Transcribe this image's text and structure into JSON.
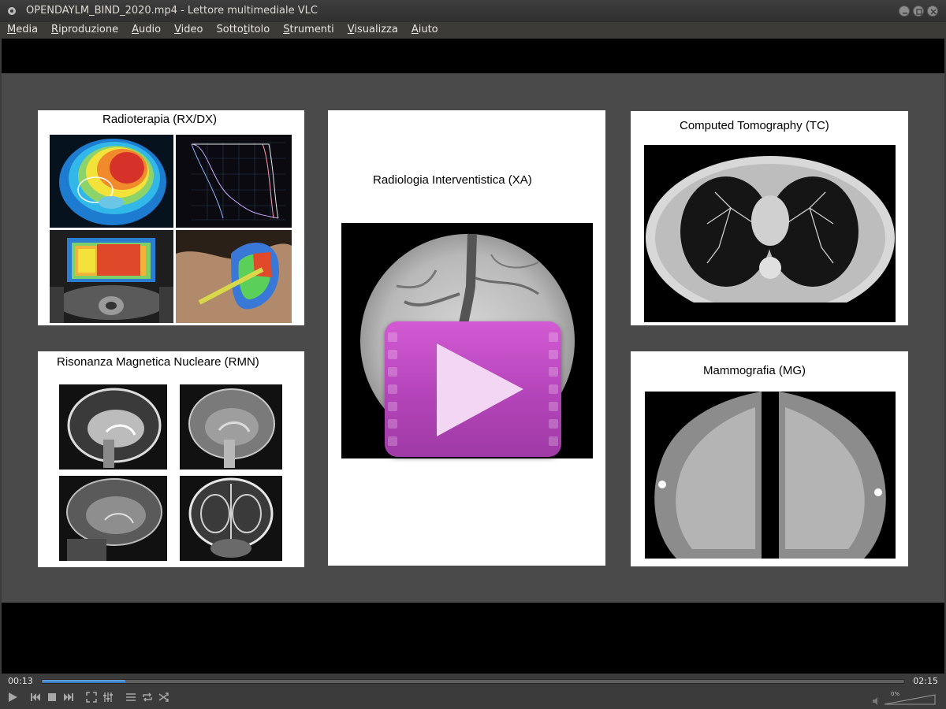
{
  "window": {
    "title": "OPENDAYLM_BIND_2020.mp4 - Lettore multimediale VLC"
  },
  "menu": [
    {
      "pre": "",
      "key": "M",
      "post": "edia"
    },
    {
      "pre": "",
      "key": "R",
      "post": "iproduzione"
    },
    {
      "pre": "",
      "key": "A",
      "post": "udio"
    },
    {
      "pre": "",
      "key": "V",
      "post": "ideo"
    },
    {
      "pre": "Sotto",
      "key": "t",
      "post": "itolo"
    },
    {
      "pre": "",
      "key": "S",
      "post": "trumenti"
    },
    {
      "pre": "",
      "key": "V",
      "post": "isualizza"
    },
    {
      "pre": "",
      "key": "A",
      "post": "iuto"
    }
  ],
  "slide": {
    "radioterapia": "Radioterapia (RX/DX)",
    "radiologia": "Radiologia Interventistica (XA)",
    "tc": "Computed Tomography (TC)",
    "rmn": "Risonanza Magnetica Nucleare (RMN)",
    "mammografia": "Mammografia (MG)"
  },
  "player": {
    "current_time": "00:13",
    "total_time": "02:15",
    "progress_fraction": 0.097,
    "volume_label": "0%"
  },
  "colors": {
    "accent": "#b444b9",
    "seek": "#3a7bc4"
  }
}
